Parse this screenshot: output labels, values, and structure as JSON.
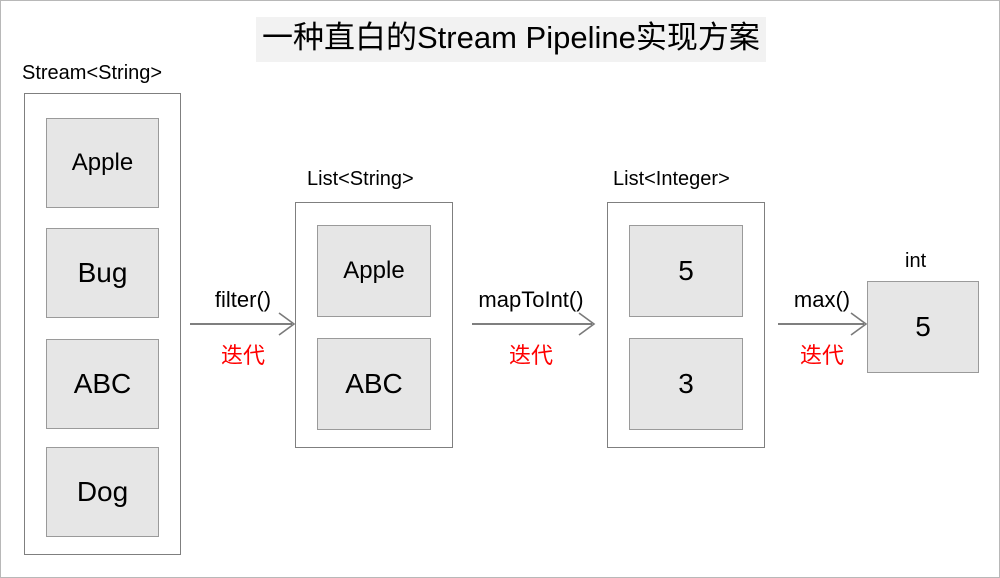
{
  "page": {
    "title": "一种直白的Stream Pipeline实现方案",
    "title_highlight_color": "#f2f2f2",
    "background_color": "#ffffff",
    "border_color": "#b8b8b8"
  },
  "colors": {
    "cell_fill": "#e6e6e6",
    "cell_border": "#9a9a9a",
    "container_border": "#7f7f7f",
    "text": "#000000",
    "accent_red": "#ff0000"
  },
  "stages": [
    {
      "id": "stream-string",
      "caption": "Stream<String>",
      "items": [
        {
          "label": "Apple"
        },
        {
          "label": "Bug"
        },
        {
          "label": "ABC"
        },
        {
          "label": "Dog"
        }
      ]
    },
    {
      "id": "list-string",
      "caption": "List<String>",
      "items": [
        {
          "label": "Apple"
        },
        {
          "label": "ABC"
        }
      ]
    },
    {
      "id": "list-integer",
      "caption": "List<Integer>",
      "items": [
        {
          "label": "5"
        },
        {
          "label": "3"
        }
      ]
    },
    {
      "id": "int-result",
      "caption": "int",
      "items": [
        {
          "label": "5"
        }
      ]
    }
  ],
  "arrows": [
    {
      "id": "filter",
      "label": "filter()",
      "sublabel": "迭代"
    },
    {
      "id": "mapToInt",
      "label": "mapToInt()",
      "sublabel": "迭代"
    },
    {
      "id": "max",
      "label": "max()",
      "sublabel": "迭代"
    }
  ]
}
